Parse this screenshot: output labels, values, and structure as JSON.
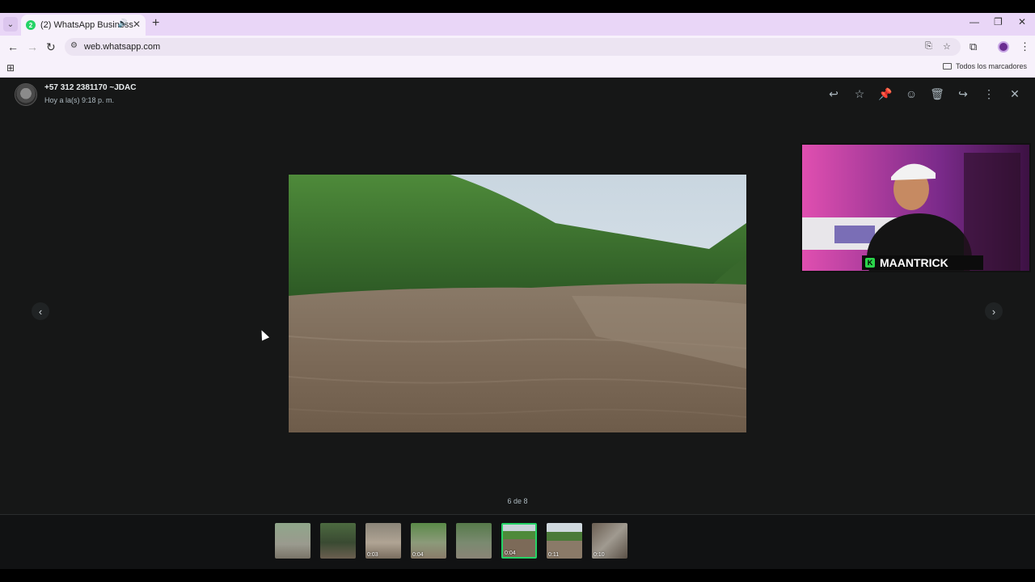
{
  "browser": {
    "tab_title": "(2) WhatsApp Business",
    "favicon_text": "2",
    "url": "web.whatsapp.com",
    "bookmarks_label": "Todos los marcadores"
  },
  "viewer": {
    "contact_name": "+57 312 2381170 ~JDAC",
    "timestamp": "Hoy a la(s) 9:18 p. m.",
    "counter": "6 de 8",
    "thumbnails": [
      {
        "duration": ""
      },
      {
        "duration": ""
      },
      {
        "duration": "0:03"
      },
      {
        "duration": "0:04"
      },
      {
        "duration": ""
      },
      {
        "duration": "0:04"
      },
      {
        "duration": "0:11"
      },
      {
        "duration": "0:10"
      }
    ],
    "accent_color": "#25d366"
  },
  "overlay": {
    "streamer_name": "MAANTRICK"
  }
}
